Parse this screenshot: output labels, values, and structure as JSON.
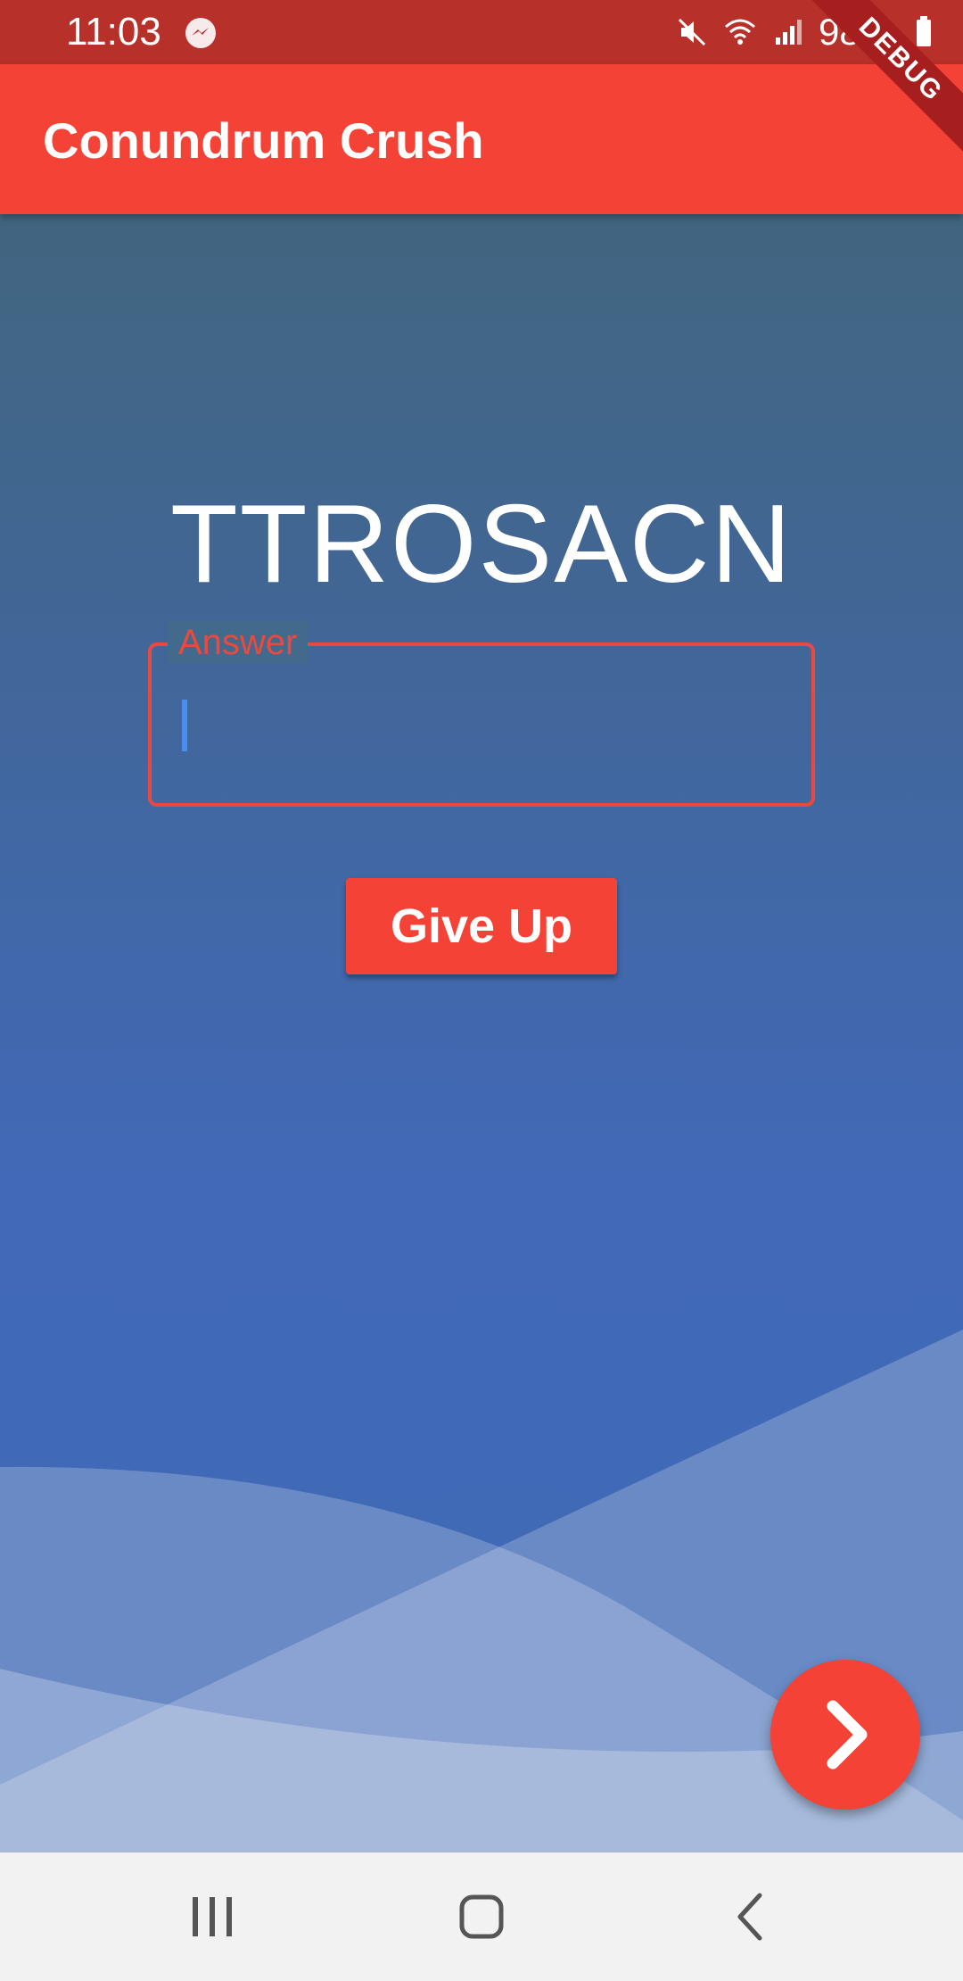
{
  "status_bar": {
    "time": "11:03",
    "battery": "98%",
    "icons": [
      "messenger-icon",
      "mute-icon",
      "wifi-icon",
      "signal-icon",
      "battery-icon"
    ]
  },
  "app_bar": {
    "title": "Conundrum Crush",
    "debug_banner": "DEBUG"
  },
  "puzzle": {
    "scrambled_word": "TTROSACN"
  },
  "answer": {
    "label": "Answer",
    "value": ""
  },
  "actions": {
    "give_up_label": "Give Up",
    "next_icon": "chevron-right-icon"
  },
  "nav": {
    "icons": [
      "recent-apps-icon",
      "home-icon",
      "back-icon"
    ]
  },
  "colors": {
    "accent": "#f44336",
    "status_bar": "#b8302a",
    "background_top": "#41657f",
    "background_bottom": "#3f6ab5",
    "cursor": "#4a8ef0"
  }
}
